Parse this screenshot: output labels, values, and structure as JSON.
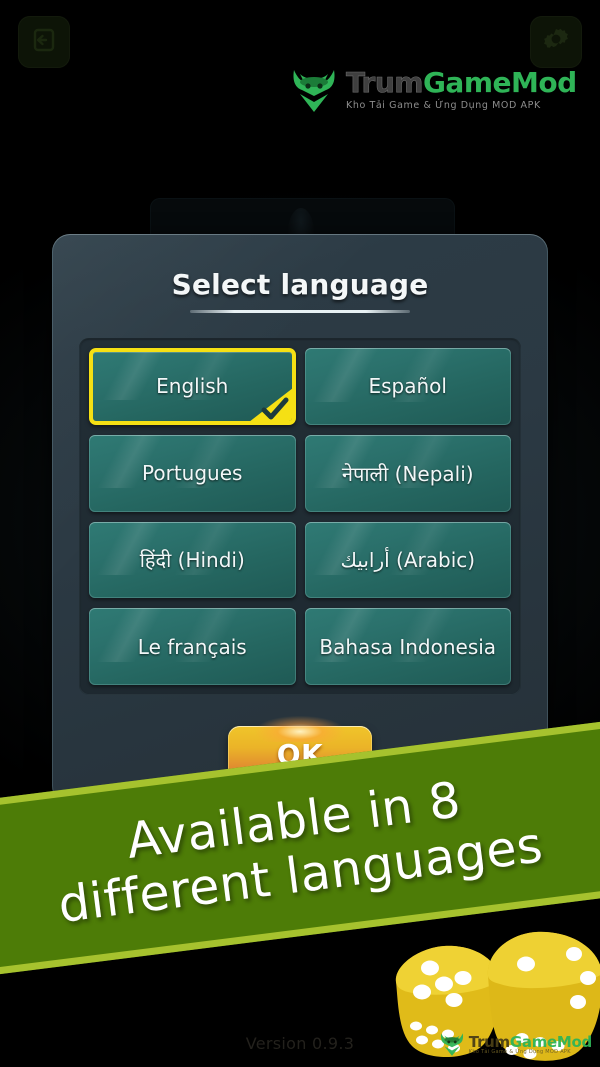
{
  "app": {
    "version_label": "Version 0.9.3"
  },
  "topbar": {
    "exit_icon": "exit-door-icon",
    "settings_icon": "gear-icon"
  },
  "logo": {
    "mark_icon": "bull-head-icon",
    "word_trum": "Trum",
    "word_game": "Game",
    "word_mod": "Mod",
    "tagline": "Kho Tải Game & Ứng Dụng MOD APK"
  },
  "dialog": {
    "title": "Select language",
    "languages": [
      {
        "label": "English",
        "selected": true
      },
      {
        "label": "Español",
        "selected": false
      },
      {
        "label": "Portugues",
        "selected": false
      },
      {
        "label": "नेपाली (Nepali)",
        "selected": false
      },
      {
        "label": "हिंदी  (Hindi)",
        "selected": false
      },
      {
        "label": "أرابيك (Arabic)",
        "selected": false
      },
      {
        "label": "Le français",
        "selected": false
      },
      {
        "label": "Bahasa Indonesia",
        "selected": false
      }
    ],
    "ok_label": "OK",
    "check_icon": "checkmark-icon"
  },
  "banner": {
    "line1": "Available in 8",
    "line2": "different languages"
  },
  "watermark": {
    "mark_icon": "bull-head-icon",
    "word_trum": "Trum",
    "word_game": "Game",
    "word_mod": "Mod",
    "tagline": "Kho Tải Game & Ứng Dụng MOD APK"
  },
  "colors": {
    "accent_yellow": "#f5e014",
    "button_teal": "#2b716c",
    "banner_green": "#4d7c07",
    "banner_edge": "#a6c22e",
    "ok_gold": "#ebb428",
    "brand_green": "#2fb457"
  }
}
